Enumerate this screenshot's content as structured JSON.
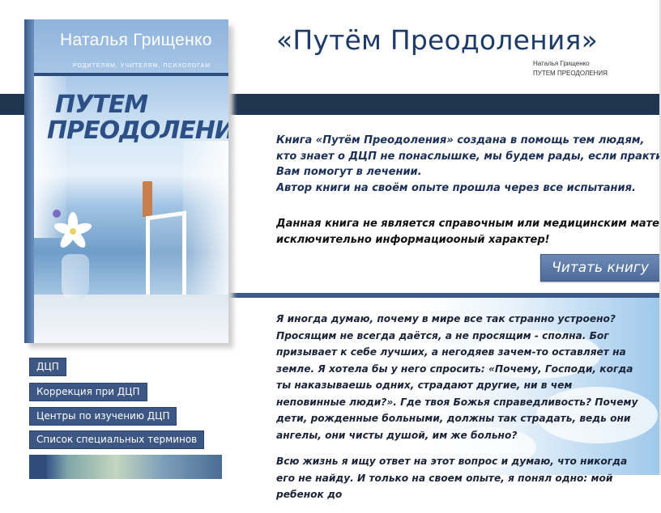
{
  "header": {
    "site_title": "«Путём Преодоления»",
    "author_line": "Наталья Грищенко",
    "book_line": "ПУТЕМ ПРЕОДОЛЕНИЯ"
  },
  "book_cover": {
    "author": "Наталья Грищенко",
    "subtitle": "РОДИТЕЛЯМ, УЧИТЕЛЯМ, ПСИХОЛОГАМ",
    "title_line1": "ПУТЕМ",
    "title_line2": "ПРЕОДОЛЕНИЯ"
  },
  "intro": {
    "lines": [
      "Книга «Путём Преодоления» создана в помощь тем людям,",
      "кто знает о ДЦП не понаслышке, мы будем рады, если практиче",
      "Вам помогут в лечении.",
      "Автор книги на своём опыте прошла через все испытания."
    ],
    "notice_lines": [
      "Данная книга не является справочным или медицинским матери",
      "исключительно информациооный характер!"
    ]
  },
  "read_button": "Читать книгу",
  "article": {
    "paragraphs": [
      "Я иногда думаю, почему в мире все так странно устроено? Просящим не всегда даётся, а не просящим - сполна. Бог призывает к себе лучших, а негодяев зачем-то оставляет на земле. Я хотела бы у него спросить: «Почему, Господи, когда ты наказываешь одних, страдают другие, ни в чем неповинные люди?». Где твоя Божья справедливость? Почему дети, рожденные больными, должны так страдать, ведь они ангелы, они чисты душой, им же больно?",
      "Всю жизнь я ищу ответ на этот вопрос и думаю, что никогда его не найду. И только на своем опыте, я понял одно: мой ребенок до"
    ]
  },
  "nav": {
    "items": [
      "ДЦП",
      "Коррекция при ДЦП",
      "Центры по изучению ДЦП",
      "Список специальных терминов"
    ]
  },
  "colors": {
    "dark_band": "#1f3550",
    "title": "#1e3a66",
    "button": "#4d6a98"
  }
}
